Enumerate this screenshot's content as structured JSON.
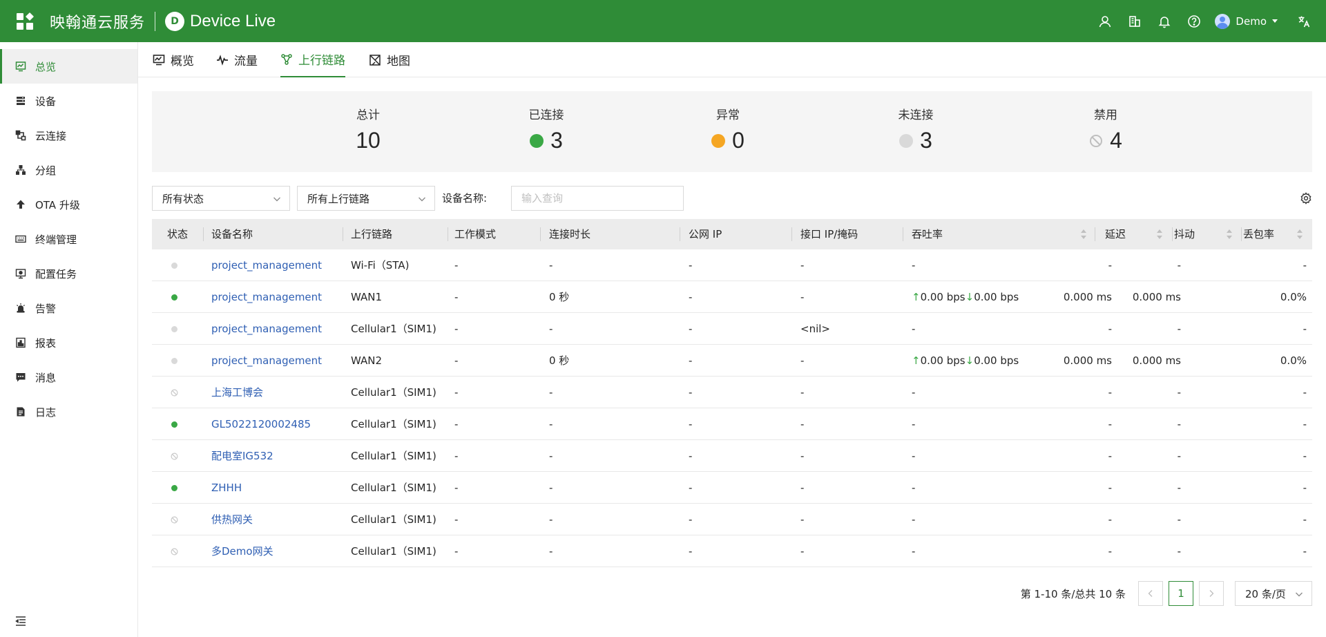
{
  "header": {
    "brand": "映翰通云服务",
    "logo_letter": "D",
    "product": "Device Live",
    "user": "Demo"
  },
  "sidebar": {
    "items": [
      {
        "label": "总览",
        "icon": "dashboard-icon",
        "active": true
      },
      {
        "label": "设备",
        "icon": "device-icon"
      },
      {
        "label": "云连接",
        "icon": "cloud-connect-icon"
      },
      {
        "label": "分组",
        "icon": "group-icon"
      },
      {
        "label": "OTA 升级",
        "icon": "upload-icon"
      },
      {
        "label": "终端管理",
        "icon": "keyboard-icon"
      },
      {
        "label": "配置任务",
        "icon": "config-task-icon"
      },
      {
        "label": "告警",
        "icon": "alarm-icon"
      },
      {
        "label": "报表",
        "icon": "report-icon"
      },
      {
        "label": "消息",
        "icon": "message-icon"
      },
      {
        "label": "日志",
        "icon": "log-icon"
      }
    ]
  },
  "tabs": [
    {
      "label": "概览",
      "icon": "monitor-icon"
    },
    {
      "label": "流量",
      "icon": "pulse-icon"
    },
    {
      "label": "上行链路",
      "icon": "uplink-icon",
      "active": true
    },
    {
      "label": "地图",
      "icon": "map-icon"
    }
  ],
  "summary": {
    "total": {
      "label": "总计",
      "value": "10"
    },
    "connected": {
      "label": "已连接",
      "value": "3",
      "color": "#3aa845"
    },
    "abnormal": {
      "label": "异常",
      "value": "0",
      "color": "#f5a623"
    },
    "disconnected": {
      "label": "未连接",
      "value": "3",
      "color": "#d9d9d9"
    },
    "disabled": {
      "label": "禁用",
      "value": "4"
    }
  },
  "filters": {
    "status": "所有状态",
    "uplink": "所有上行链路",
    "name_label": "设备名称:",
    "name_placeholder": "输入查询"
  },
  "table": {
    "columns": [
      "状态",
      "设备名称",
      "上行链路",
      "工作模式",
      "连接时长",
      "公网 IP",
      "接口 IP/掩码",
      "吞吐率",
      "延迟",
      "抖动",
      "丢包率"
    ],
    "rows": [
      {
        "status": "offline",
        "name": "project_management",
        "uplink": "Wi-Fi（STA)",
        "mode": "-",
        "duration": "-",
        "public_ip": "-",
        "iface_ip": "-",
        "up": "",
        "down": "",
        "throughput": "-",
        "latency": "-",
        "jitter": "-",
        "loss": "-"
      },
      {
        "status": "online",
        "name": "project_management",
        "uplink": "WAN1",
        "mode": "-",
        "duration": "0 秒",
        "public_ip": "-",
        "iface_ip": "-",
        "up": "0.00 bps",
        "down": "0.00 bps",
        "throughput": "",
        "latency": "0.000 ms",
        "jitter": "0.000 ms",
        "loss": "0.0%"
      },
      {
        "status": "offline",
        "name": "project_management",
        "uplink": "Cellular1（SIM1)",
        "mode": "-",
        "duration": "-",
        "public_ip": "-",
        "iface_ip": "<nil>",
        "up": "",
        "down": "",
        "throughput": "-",
        "latency": "-",
        "jitter": "-",
        "loss": "-"
      },
      {
        "status": "offline",
        "name": "project_management",
        "uplink": "WAN2",
        "mode": "-",
        "duration": "0 秒",
        "public_ip": "-",
        "iface_ip": "-",
        "up": "0.00 bps",
        "down": "0.00 bps",
        "throughput": "",
        "latency": "0.000 ms",
        "jitter": "0.000 ms",
        "loss": "0.0%"
      },
      {
        "status": "disabled",
        "name": "上海工博会",
        "uplink": "Cellular1（SIM1)",
        "mode": "-",
        "duration": "-",
        "public_ip": "-",
        "iface_ip": "-",
        "up": "",
        "down": "",
        "throughput": "-",
        "latency": "-",
        "jitter": "-",
        "loss": "-"
      },
      {
        "status": "online",
        "name": "GL5022120002485",
        "uplink": "Cellular1（SIM1)",
        "mode": "-",
        "duration": "-",
        "public_ip": "-",
        "iface_ip": "-",
        "up": "",
        "down": "",
        "throughput": "-",
        "latency": "-",
        "jitter": "-",
        "loss": "-"
      },
      {
        "status": "disabled",
        "name": "配电室IG532",
        "uplink": "Cellular1（SIM1)",
        "mode": "-",
        "duration": "-",
        "public_ip": "-",
        "iface_ip": "-",
        "up": "",
        "down": "",
        "throughput": "-",
        "latency": "-",
        "jitter": "-",
        "loss": "-"
      },
      {
        "status": "online",
        "name": "ZHHH",
        "uplink": "Cellular1（SIM1)",
        "mode": "-",
        "duration": "-",
        "public_ip": "-",
        "iface_ip": "-",
        "up": "",
        "down": "",
        "throughput": "-",
        "latency": "-",
        "jitter": "-",
        "loss": "-"
      },
      {
        "status": "disabled",
        "name": "供热网关",
        "uplink": "Cellular1（SIM1)",
        "mode": "-",
        "duration": "-",
        "public_ip": "-",
        "iface_ip": "-",
        "up": "",
        "down": "",
        "throughput": "-",
        "latency": "-",
        "jitter": "-",
        "loss": "-"
      },
      {
        "status": "disabled",
        "name": "多Demo网关",
        "uplink": "Cellular1（SIM1)",
        "mode": "-",
        "duration": "-",
        "public_ip": "-",
        "iface_ip": "-",
        "up": "",
        "down": "",
        "throughput": "-",
        "latency": "-",
        "jitter": "-",
        "loss": "-"
      }
    ]
  },
  "pagination": {
    "total_text": "第 1-10 条/总共 10 条",
    "current_page": "1",
    "page_size": "20 条/页"
  },
  "colors": {
    "brand": "#2f8c37",
    "online": "#3aa845",
    "offline": "#d9d9d9",
    "link": "#2f5fb3"
  }
}
